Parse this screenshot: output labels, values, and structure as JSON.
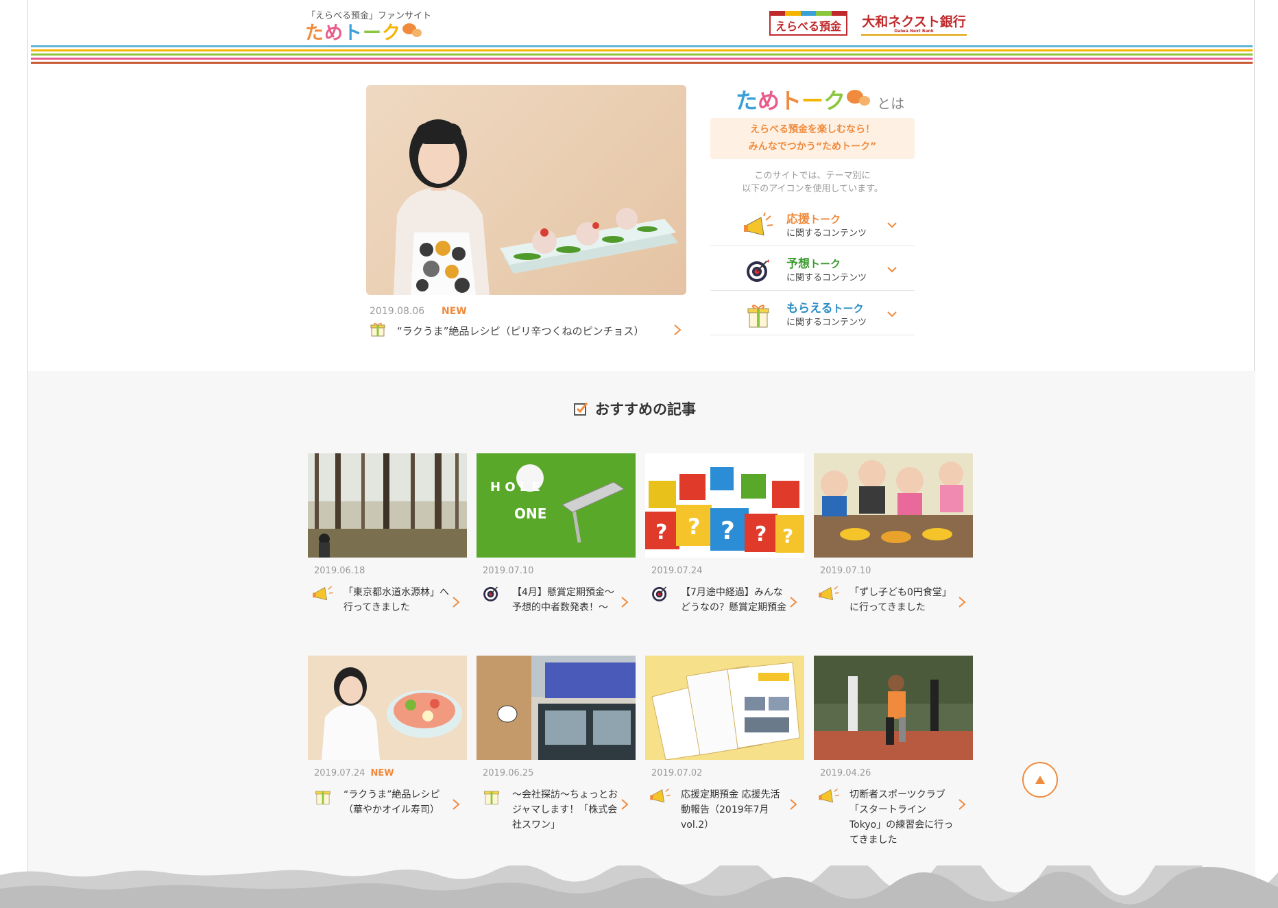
{
  "header": {
    "site_sub": "「えらべる預金」ファンサイト",
    "logo_text": [
      "た",
      "め",
      "ト",
      "ー",
      "ク"
    ],
    "logo_colors": [
      "#f08a3c",
      "#e95b8a",
      "#3aa0d8",
      "#8cc63f",
      "#f5b400"
    ],
    "brand1_label": "えらべる預金",
    "brand2_label": "大和ネクスト銀行",
    "brand2_sub": "Daiwa Next Bank"
  },
  "stripe_colors": [
    "#5fb4d6",
    "#f5b400",
    "#8cc63f",
    "#e95b8a",
    "#f08a3c"
  ],
  "hero": {
    "date": "2019.08.06",
    "new_badge": "NEW",
    "title": "“ラクうま”絶品レシピ（ピリ辛つくねのピンチョス）"
  },
  "about": {
    "towa": "とは",
    "catch_line1": "えらべる預金を楽しむなら！",
    "catch_line2": "みんなでつかう“ためトーク”",
    "desc_line1": "このサイトでは、テーマ別に",
    "desc_line2": "以下のアイコンを使用しています。",
    "categories": [
      {
        "name_a": "応援",
        "name_b": "トーク",
        "color": "#f08a3c",
        "sub": "に関するコンテンツ",
        "icon": "megaphone-icon"
      },
      {
        "name_a": "予想",
        "name_b": "トーク",
        "color": "#3a9a2e",
        "sub": "に関するコンテンツ",
        "icon": "target-icon"
      },
      {
        "name_a": "もらえる",
        "name_b": "トーク",
        "color": "#2a8dc5",
        "sub": "に関するコンテンツ",
        "icon": "gift-icon"
      }
    ]
  },
  "recommended": {
    "heading": "おすすめの記事",
    "articles": [
      {
        "date": "2019.06.18",
        "new": "",
        "icon": "megaphone-icon",
        "title": "「東京都水道水源林」へ行ってきました"
      },
      {
        "date": "2019.07.10",
        "new": "",
        "icon": "target-icon",
        "title": "【4月】懸賞定期預金～予想的中者数発表！～"
      },
      {
        "date": "2019.07.24",
        "new": "",
        "icon": "target-icon",
        "title": "【7月途中経過】みんなどうなの？懸賞定期預金"
      },
      {
        "date": "2019.07.10",
        "new": "",
        "icon": "megaphone-icon",
        "title": "「ずし子ども0円食堂」に行ってきました"
      },
      {
        "date": "2019.07.24",
        "new": "NEW",
        "icon": "gift-icon",
        "title": "“ラクうま”絶品レシピ（華やかオイル寿司）"
      },
      {
        "date": "2019.06.25",
        "new": "",
        "icon": "gift-icon",
        "title": "～会社探訪～ちょっとおジャマします！「株式会社スワン」"
      },
      {
        "date": "2019.07.02",
        "new": "",
        "icon": "megaphone-icon",
        "title": "応援定期預金 応援先活動報告（2019年7月vol.2）"
      },
      {
        "date": "2019.04.26",
        "new": "",
        "icon": "megaphone-icon",
        "title": "切断者スポーツクラブ「スタートライン Tokyo」の練習会に行ってきました"
      }
    ],
    "golf_word_1": "H O L E",
    "golf_word_2": "ONE"
  },
  "accent_color": "#f08a3c"
}
